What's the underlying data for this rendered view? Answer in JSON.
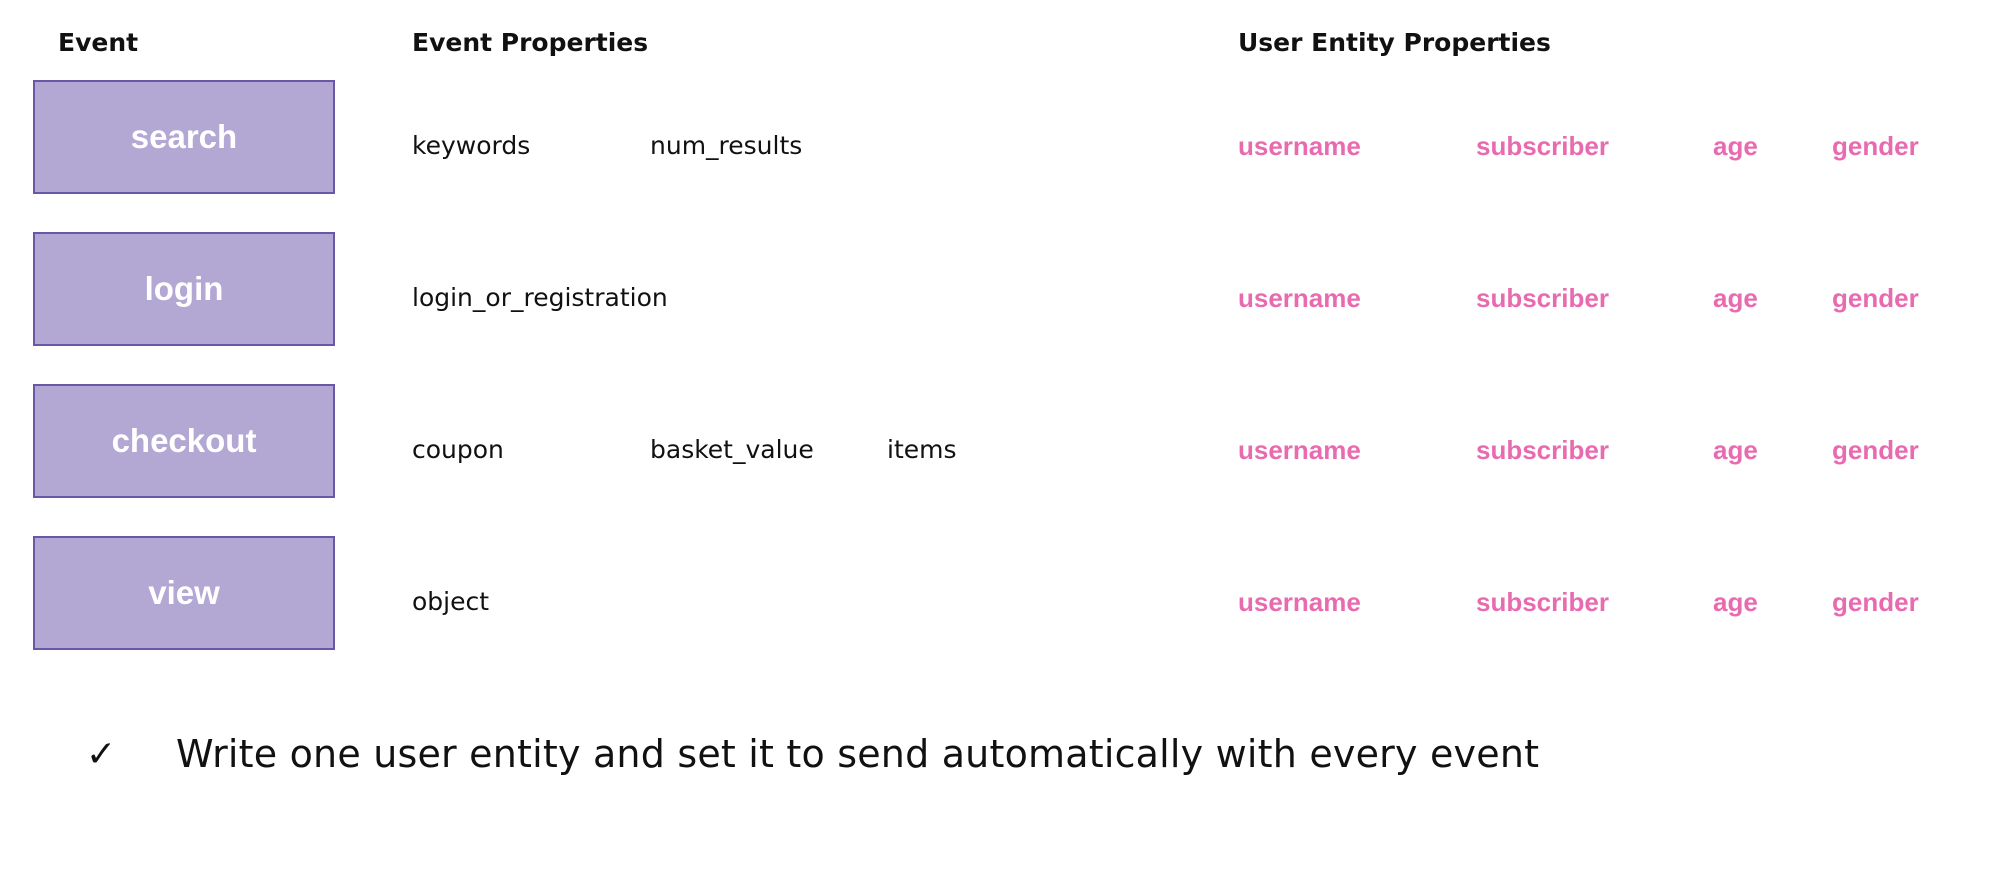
{
  "headers": {
    "event": "Event",
    "event_properties": "Event Properties",
    "user_entity_properties": "User Entity Properties"
  },
  "colors": {
    "event_box_fill": "#b3a8d3",
    "event_box_border": "#6a57a6",
    "user_property_text": "#e86bb0"
  },
  "rows": [
    {
      "event": "search",
      "event_properties": [
        "keywords",
        "num_results",
        ""
      ],
      "user_properties": [
        "username",
        "subscriber",
        "age",
        "gender"
      ]
    },
    {
      "event": "login",
      "event_properties": [
        "login_or_registration",
        "",
        ""
      ],
      "user_properties": [
        "username",
        "subscriber",
        "age",
        "gender"
      ]
    },
    {
      "event": "checkout",
      "event_properties": [
        "coupon",
        "basket_value",
        "items"
      ],
      "user_properties": [
        "username",
        "subscriber",
        "age",
        "gender"
      ]
    },
    {
      "event": "view",
      "event_properties": [
        "object",
        "",
        ""
      ],
      "user_properties": [
        "username",
        "subscriber",
        "age",
        "gender"
      ]
    }
  ],
  "note": {
    "icon": "check-mark-icon",
    "check_glyph": "✓",
    "text": "Write one user entity and set it to send automatically with every event"
  }
}
